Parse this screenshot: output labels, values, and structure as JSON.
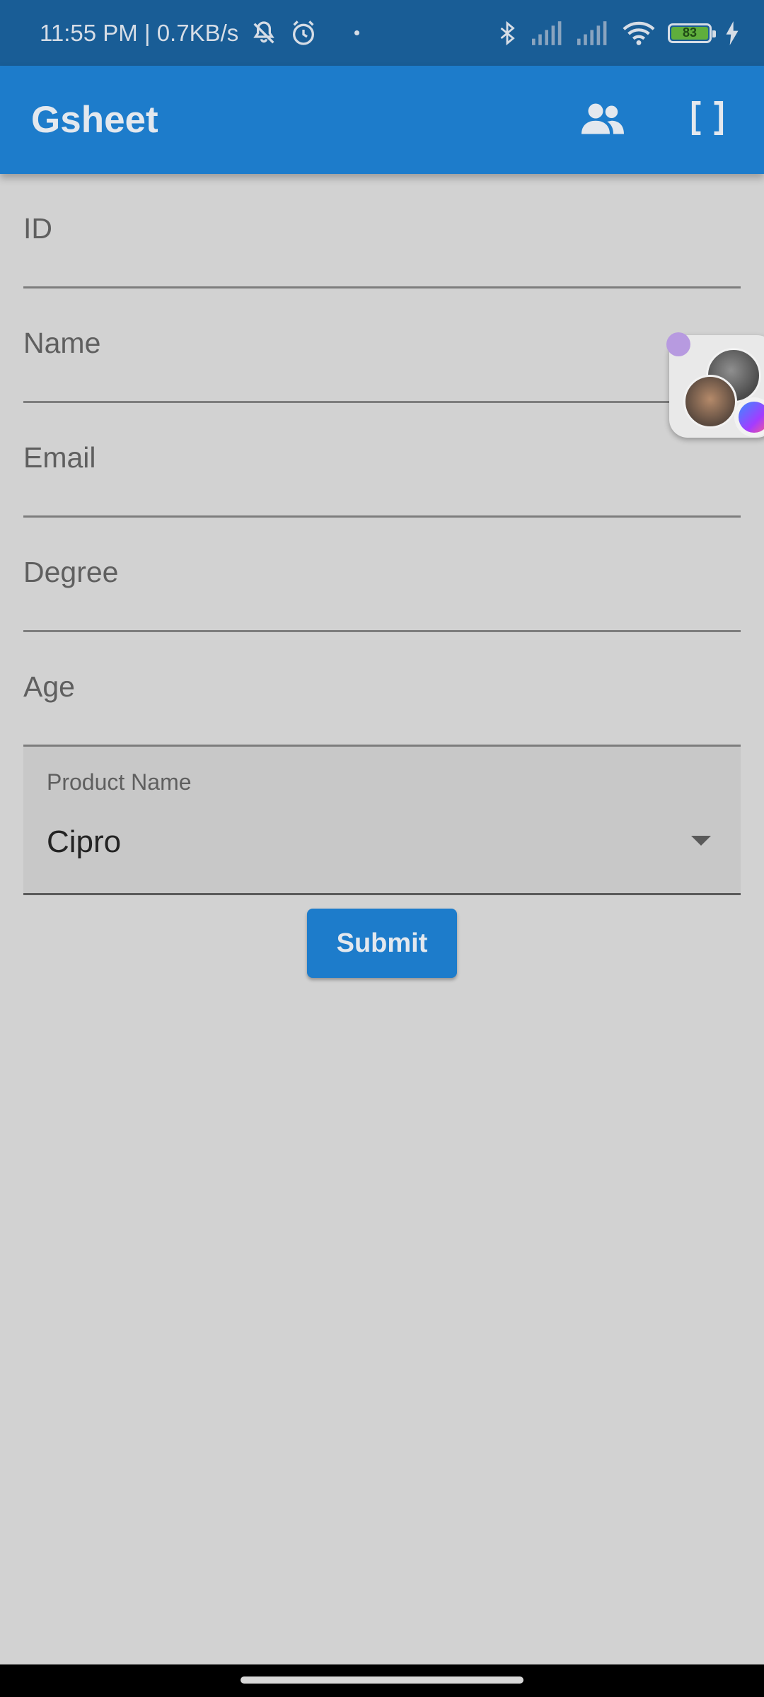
{
  "status_bar": {
    "time_speed": "11:55 PM | 0.7KB/s",
    "battery": "83",
    "icons": [
      "mute-bell-icon",
      "alarm-icon",
      "bluetooth-icon",
      "signal-icon",
      "signal-icon",
      "wifi-icon",
      "battery-icon",
      "charging-icon"
    ]
  },
  "app_bar": {
    "title": "Gsheet",
    "actions": [
      "people-icon",
      "brackets-icon"
    ]
  },
  "form": {
    "fields": [
      {
        "label": "ID"
      },
      {
        "label": "Name"
      },
      {
        "label": "Email"
      },
      {
        "label": "Degree"
      },
      {
        "label": "Age"
      }
    ],
    "product": {
      "label": "Product Name",
      "value": "Cipro"
    },
    "submit_label": "Submit"
  },
  "colors": {
    "status_bar": "#195d96",
    "app_bar": "#1d7ccb",
    "background": "#d2d2d2",
    "button": "#1d7ccb"
  }
}
